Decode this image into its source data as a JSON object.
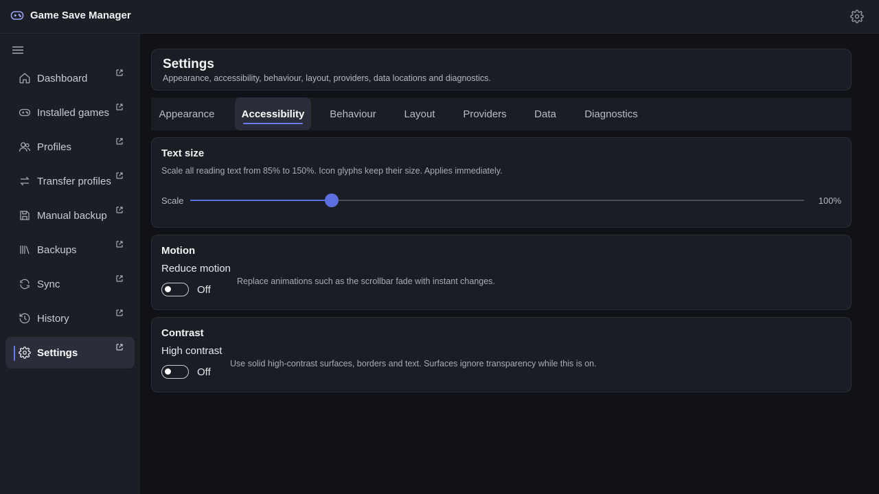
{
  "app": {
    "title": "Game Save Manager",
    "icon": "gamepad-icon",
    "settings_icon": "gear-icon"
  },
  "sidebar": {
    "menu_icon": "hamburger-menu-icon",
    "items": [
      {
        "label": "Dashboard",
        "icon": "home-icon",
        "active": false
      },
      {
        "label": "Installed games",
        "icon": "gamepad-icon",
        "active": false
      },
      {
        "label": "Profiles",
        "icon": "users-icon",
        "active": false
      },
      {
        "label": "Transfer profiles",
        "icon": "transfer-arrows-icon",
        "active": false
      },
      {
        "label": "Manual backup",
        "icon": "save-disk-icon",
        "active": false
      },
      {
        "label": "Backups",
        "icon": "library-icon",
        "active": false
      },
      {
        "label": "Sync",
        "icon": "refresh-icon",
        "active": false
      },
      {
        "label": "History",
        "icon": "history-icon",
        "active": false
      },
      {
        "label": "Settings",
        "icon": "gear-icon",
        "active": true
      }
    ]
  },
  "header": {
    "title": "Settings",
    "subtitle": "Appearance, accessibility, behaviour, layout, providers, data locations and diagnostics."
  },
  "tabs": [
    {
      "label": "Appearance",
      "active": false
    },
    {
      "label": "Accessibility",
      "active": true
    },
    {
      "label": "Behaviour",
      "active": false
    },
    {
      "label": "Layout",
      "active": false
    },
    {
      "label": "Providers",
      "active": false
    },
    {
      "label": "Data",
      "active": false
    },
    {
      "label": "Diagnostics",
      "active": false
    }
  ],
  "text_size": {
    "title": "Text size",
    "description": "Scale all reading text from 85% to 150%. Icon glyphs keep their size. Applies immediately.",
    "scale_label": "Scale",
    "value_text": "100%",
    "value_percent": 100,
    "min_percent": 85,
    "max_percent": 150
  },
  "motion": {
    "title": "Motion",
    "setting_label": "Reduce motion",
    "state": "Off",
    "enabled": false,
    "help": "Replace animations such as the scrollbar fade with instant changes."
  },
  "contrast": {
    "title": "Contrast",
    "setting_label": "High contrast",
    "state": "Off",
    "enabled": false,
    "help": "Use solid high-contrast surfaces, borders and text. Surfaces ignore transparency while this is on."
  },
  "colors": {
    "accent": "#5b6fe0",
    "background": "#111217",
    "surface": "#1b1d24"
  }
}
